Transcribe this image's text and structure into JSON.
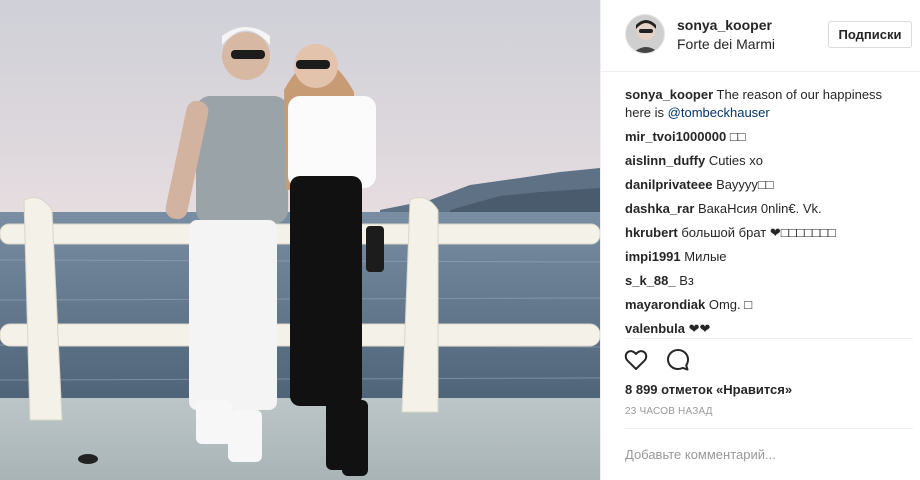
{
  "post": {
    "username": "sonya_kooper",
    "location": "Forte dei Marmi",
    "follow_label": "Подписки",
    "photo_description": "",
    "caption": {
      "user": "sonya_kooper",
      "text": "The reason of our happiness here is",
      "mention": "@tombeckhauser"
    },
    "comments": [
      {
        "user": "mir_tvoi1000000",
        "text": "□□"
      },
      {
        "user": "aislinn_duffy",
        "text": "Cuties xo"
      },
      {
        "user": "danilprivateee",
        "text": "Вауууу□□"
      },
      {
        "user": "dashka_rar",
        "text": "ВакаНсия 0nlin€. Vk."
      },
      {
        "user": "hkrubert",
        "text": "большой брат ❤□□□□□□□"
      },
      {
        "user": "impi1991",
        "text": "Милые"
      },
      {
        "user": "s_k_88_",
        "text": "Вз"
      },
      {
        "user": "mayarondiak",
        "text": "Omg. □"
      },
      {
        "user": "valenbula",
        "text": "❤❤"
      }
    ],
    "likes": "8 899 отметок «Нравится»",
    "time": "23 часов назад",
    "add_comment_placeholder": "Добавьте комментарий..."
  },
  "icons": {
    "like": "heart-icon",
    "comment": "comment-icon"
  }
}
